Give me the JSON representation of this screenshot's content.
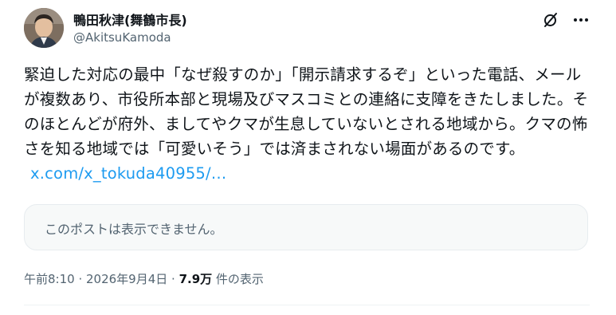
{
  "author": {
    "display_name": "鴨田秋津(舞鶴市長)",
    "handle": "@AkitsuKamoda",
    "avatar_icon": "profile-photo"
  },
  "header_icons": {
    "grok": "grok-slash-icon",
    "more": "more-horizontal-icon"
  },
  "post": {
    "text": "緊迫した対応の最中「なぜ殺すのか」「開示請求するぞ」といった電話、メールが複数あり、市役所本部と現場及びマスコミとの連絡に支障をきたしました。そのほとんどが府外、ましてやクマが生息していないとされる地域から。クマの怖さを知る地域では「可愛いそう」では済まされない場面があるのです。",
    "link": "x.com/x_tokuda40955/…"
  },
  "quoted_post": {
    "unavailable_text": "このポストは表示できません。"
  },
  "meta": {
    "time": "午前8:10",
    "separator1": " · ",
    "date": "2026年9月4日",
    "separator2": " · ",
    "views_count": "7.9万",
    "views_label": " 件の表示"
  },
  "colors": {
    "text": "#0f1419",
    "secondary": "#536471",
    "link": "#1d9bf0",
    "card_bg": "#f7f9f9"
  }
}
